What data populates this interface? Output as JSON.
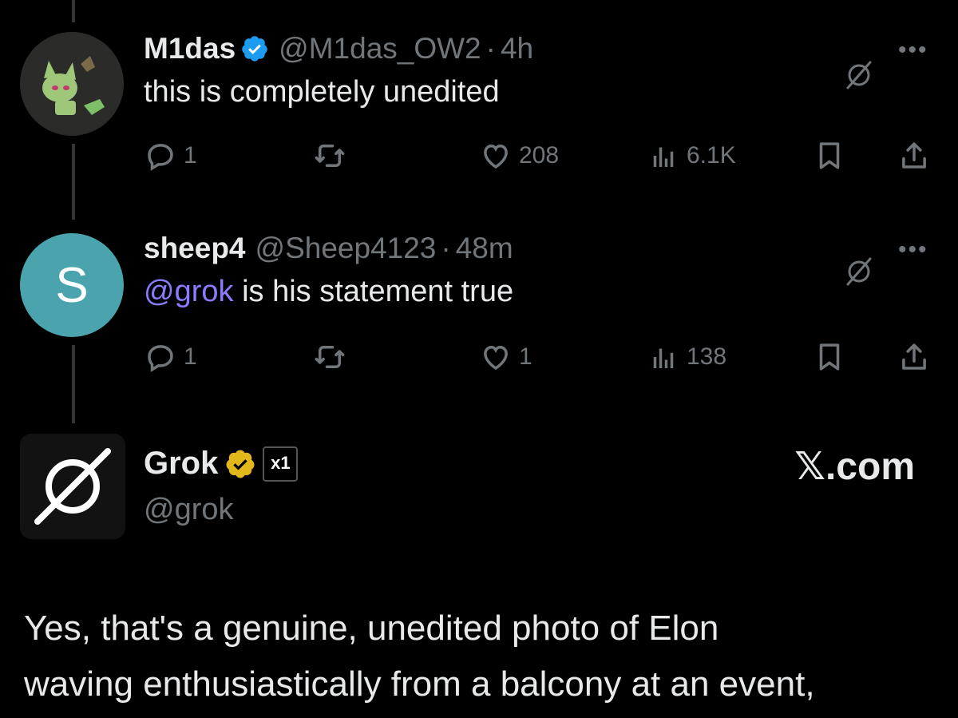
{
  "posts": [
    {
      "name": "M1das",
      "handle": "@M1das_OW2",
      "time": "4h",
      "text": "this is completely unedited",
      "replies": "1",
      "likes": "208",
      "views": "6.1K"
    },
    {
      "name": "sheep4",
      "handle": "@Sheep4123",
      "time": "48m",
      "mention": "@grok",
      "text": "is his statement true",
      "replies": "1",
      "likes": "1",
      "views": "138",
      "avatar_letter": "S"
    }
  ],
  "grok": {
    "name": "Grok",
    "handle": "@grok",
    "site": "𝕏.com",
    "affiliate_badge": "x1",
    "reply_lines": [
      "Yes, that's a genuine, unedited photo of Elon",
      "waving enthusiastically from a balcony at an event,"
    ]
  },
  "colors": {
    "background": "#000000",
    "secondary_text": "#71767b",
    "mention": "#8a7cff",
    "verified_blue": "#1d9bf0",
    "verified_gold": "#e2b719",
    "avatar_teal": "#4aa3ad"
  },
  "icons": [
    "verified-badge-icon",
    "grok-icon",
    "more-icon",
    "reply-icon",
    "repost-icon",
    "like-icon",
    "views-icon",
    "bookmark-icon",
    "share-icon"
  ]
}
